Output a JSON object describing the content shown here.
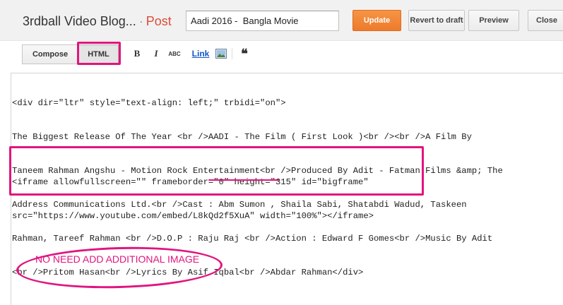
{
  "header": {
    "blog_title": "3rdball Video Blog...",
    "separator": "·",
    "post_label": "Post",
    "post_title_value": "Aadi 2016 -  Bangla Movie",
    "buttons": {
      "update": "Update",
      "revert": "Revert to draft",
      "preview": "Preview",
      "close": "Close"
    }
  },
  "toolbar": {
    "compose": "Compose",
    "html": "HTML",
    "bold": "B",
    "italic": "I",
    "strike": "ABC",
    "link": "Link",
    "image_icon": "image-icon",
    "quote": "❝"
  },
  "editor": {
    "lines_block1": [
      "<div dir=\"ltr\" style=\"text-align: left;\" trbidi=\"on\">",
      "The Biggest Release Of The Year <br />AADI - The Film ( First Look )<br /><br />A Film By",
      "Taneem Rahman Angshu - Motion Rock Entertainment<br />Produced By Adit - Fatman Films &amp; The",
      "Address Communications Ltd.<br />Cast : Abm Sumon , Shaila Sabi, Shatabdi Wadud, Taskeen",
      "Rahman, Tareef Rahman <br />D.O.P : Raju Raj <br />Action : Edward F Gomes<br />Music By Adit",
      "<br />Pritom Hasan<br />Lyrics By Asif Iqbal<br />Abdar Rahman</div>"
    ],
    "lines_block2": [
      "<iframe allowfullscreen=\"\" frameborder=\"0\" height=\"315\" id=\"bigframe\"",
      "src=\"https://www.youtube.com/embed/L8kQd2f5XuA\" width=\"100%\"></iframe>"
    ]
  },
  "annotation": {
    "note": "NO NEED ADD ADDITIONAL IMAGE",
    "color": "#e0157f"
  },
  "colors": {
    "accent_orange": "#f0833a",
    "post_red": "#dd4b39",
    "link_blue": "#1155cc"
  }
}
